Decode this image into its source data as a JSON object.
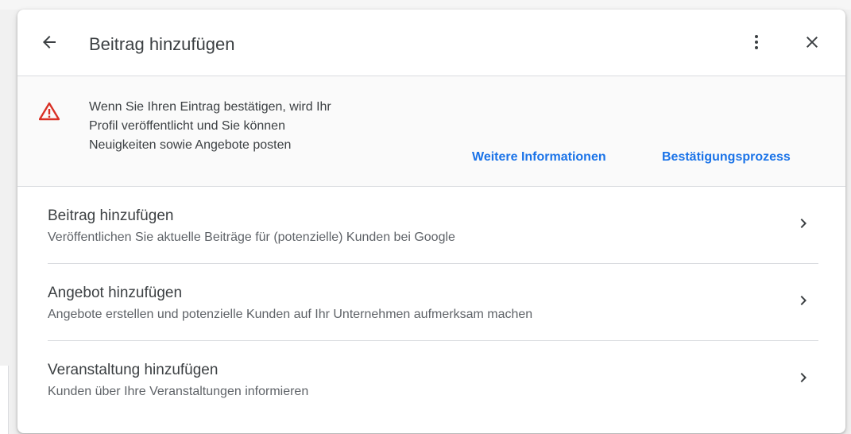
{
  "dialog": {
    "title": "Beitrag hinzufügen",
    "icons": {
      "back": "arrow-back-icon",
      "more": "more-vert-icon",
      "close": "close-icon"
    }
  },
  "notice": {
    "icon": "warning-icon",
    "lines": [
      "Wenn Sie Ihren Eintrag bestätigen, wird Ihr",
      "Profil veröffentlicht und Sie können",
      "Neuigkeiten sowie Angebote posten"
    ],
    "links": {
      "more_info": "Weitere Informationen",
      "verification": "Bestätigungsprozess"
    }
  },
  "options": [
    {
      "title": "Beitrag hinzufügen",
      "description": "Veröffentlichen Sie aktuelle Beiträge für (potenzielle) Kunden bei Google"
    },
    {
      "title": "Angebot hinzufügen",
      "description": "Angebote erstellen und potenzielle Kunden auf Ihr Unternehmen aufmerksam machen"
    },
    {
      "title": "Veranstaltung hinzufügen",
      "description": "Kunden über Ihre Veranstaltungen informieren"
    }
  ],
  "colors": {
    "link": "#1a73e8",
    "warning": "#d93025",
    "text_primary": "#3c4043",
    "text_secondary": "#5f6368",
    "divider": "#dadce0"
  }
}
